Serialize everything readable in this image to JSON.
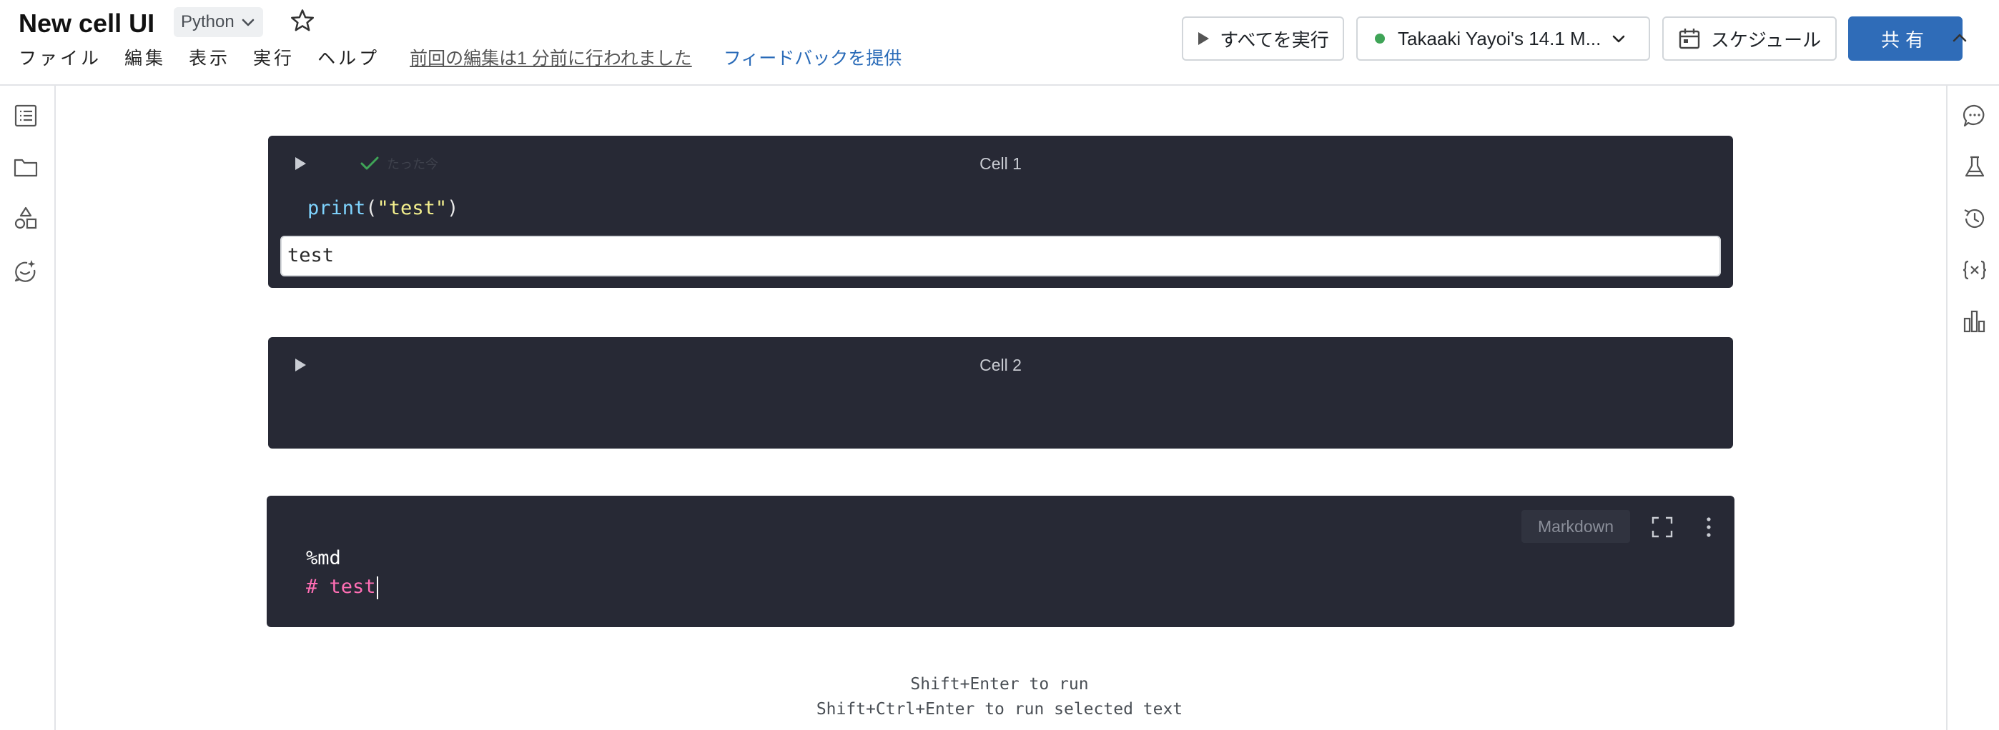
{
  "notebook": {
    "title": "New cell UI",
    "language": "Python"
  },
  "menu": {
    "items": [
      "ファイル",
      "編集",
      "表示",
      "実行",
      "ヘルプ"
    ],
    "last_edit": "前回の編集は1 分前に行われました",
    "feedback": "フィードバックを提供"
  },
  "toolbar": {
    "run_all": "すべてを実行",
    "cluster": "Takaaki Yayoi's 14.1 M...",
    "cluster_status_color": "#3fa457",
    "schedule": "スケジュール",
    "share": "共有"
  },
  "left_rail_icons": [
    "table-of-contents-icon",
    "folder-icon",
    "shapes-icon",
    "assistant-icon"
  ],
  "right_rail_icons": [
    "comments-icon",
    "experiment-icon",
    "history-icon",
    "variables-icon",
    "data-profile-icon"
  ],
  "cells": [
    {
      "title": "Cell 1",
      "status_text": "たった今",
      "code": {
        "fn": "print",
        "open": "(",
        "str": "\"test\"",
        "close": ")"
      },
      "output": "test"
    },
    {
      "title": "Cell 2"
    },
    {
      "badge": "Markdown",
      "line1": "%md",
      "line2": "# test"
    }
  ],
  "hints": {
    "run": "Shift+Enter to run",
    "run_selected": "Shift+Ctrl+Enter to run selected text"
  },
  "colors": {
    "accent": "#2f6cb8",
    "cell_bg": "#272935",
    "success": "#3fa457"
  }
}
